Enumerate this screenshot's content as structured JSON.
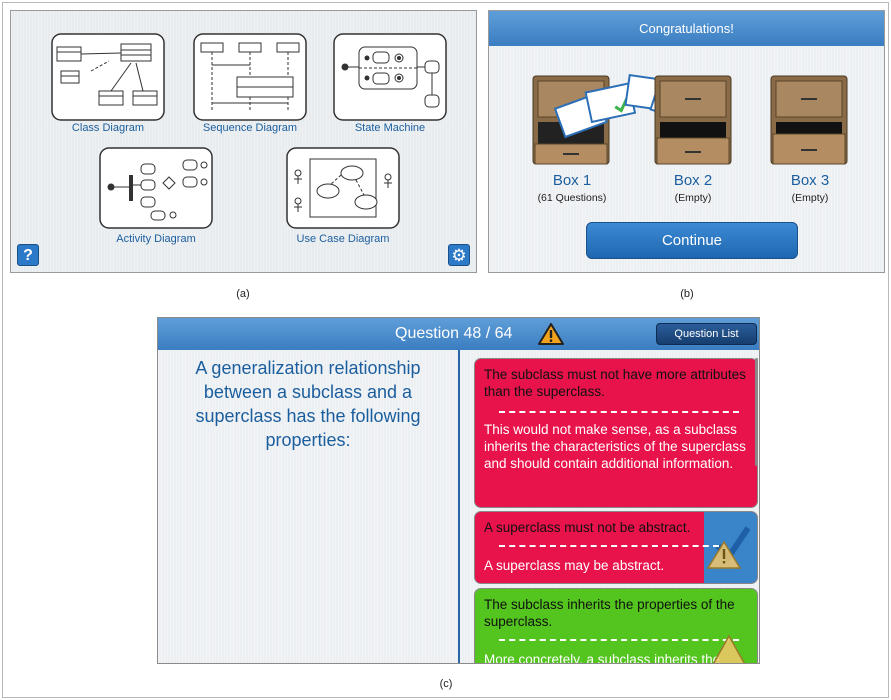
{
  "panel_a": {
    "diagrams": [
      {
        "label": "Class Diagram"
      },
      {
        "label": "Sequence Diagram"
      },
      {
        "label": "State Machine"
      },
      {
        "label": "Activity Diagram"
      },
      {
        "label": "Use Case Diagram"
      }
    ],
    "help_label": "?",
    "settings_icon": "gear-icon"
  },
  "panel_b": {
    "header": "Congratulations!",
    "boxes": [
      {
        "title": "Box 1",
        "subtitle": "(61 Questions)"
      },
      {
        "title": "Box 2",
        "subtitle": "(Empty)"
      },
      {
        "title": "Box 3",
        "subtitle": "(Empty)"
      }
    ],
    "continue_label": "Continue"
  },
  "panel_c": {
    "title": "Question 48 / 64",
    "question_list_label": "Question List",
    "question": "A generalization relationship between a subclass and a superclass has the following properties:",
    "answers": [
      {
        "statement": "The subclass must not have more attributes than the superclass.",
        "explanation": "This would not make sense, as a subclass inherits the characteristics of the superclass and should contain additional information.",
        "correct": false
      },
      {
        "statement": "A superclass must not be abstract.",
        "explanation": "A superclass may be abstract.",
        "correct": false
      },
      {
        "statement": "The subclass inherits the properties of the superclass.",
        "explanation": "More concretely, a subclass inherits the",
        "correct": true
      }
    ]
  },
  "captions": {
    "a": "(a)",
    "b": "(b)",
    "c": "(c)"
  },
  "colors": {
    "accent_blue": "#1b5e9e",
    "header_blue": "#3a7dc1",
    "wrong_red": "#e8134b",
    "right_green": "#54c51e",
    "warning_orange": "#f2a21b"
  }
}
